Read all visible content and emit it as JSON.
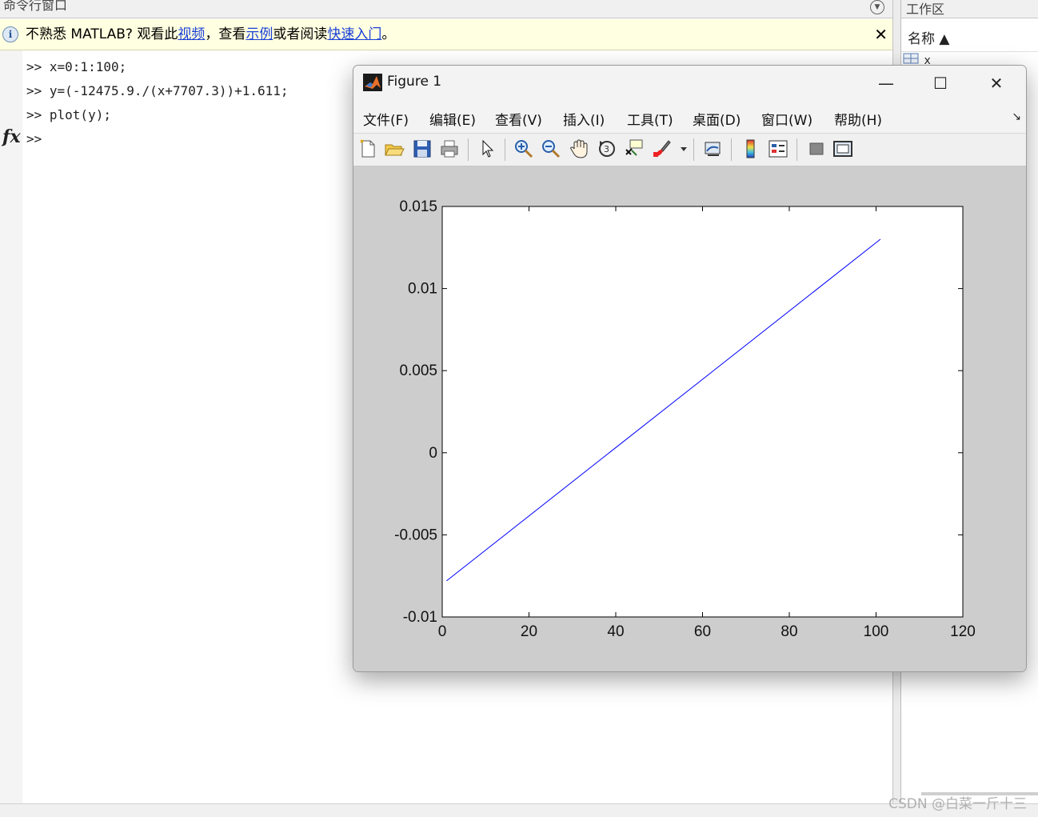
{
  "command_window": {
    "title": "命令行窗口",
    "menu_icon": "chevron-down-icon",
    "info_bar": {
      "icon": "info-icon",
      "text_before": "不熟悉 MATLAB? 观看此",
      "link_video": "视频",
      "text_mid1": "，查看",
      "link_examples": "示例",
      "text_mid2": "或者阅读",
      "link_quickstart": "快速入门",
      "text_end": "。",
      "close": "✕"
    },
    "lines": [
      ">> x=0:1:100;",
      ">> y=(-12475.9./(x+7707.3))+1.611;",
      ">> plot(y);",
      ">>"
    ],
    "fx_label": "fx"
  },
  "workspace": {
    "title": "工作区",
    "column_name": "名称 ▲",
    "variable_hint": "x"
  },
  "figure": {
    "title": "Figure 1",
    "window_controls": {
      "minimize": "—",
      "maximize": "☐",
      "close": "✕"
    },
    "menus": [
      "文件(F)",
      "编辑(E)",
      "查看(V)",
      "插入(I)",
      "工具(T)",
      "桌面(D)",
      "窗口(W)",
      "帮助(H)"
    ],
    "menu_dock": "↘",
    "toolbar": [
      "new-figure-icon",
      "open-file-icon",
      "save-icon",
      "print-icon",
      "edit-plot-arrow-icon",
      "zoom-in-icon",
      "zoom-out-icon",
      "pan-hand-icon",
      "rotate-3d-icon",
      "data-cursor-icon",
      "brush-icon",
      "link-plot-icon",
      "colorbar-icon",
      "legend-icon",
      "hide-plot-tools-icon",
      "show-plot-tools-icon"
    ]
  },
  "chart_data": {
    "type": "line",
    "x": [
      1,
      101
    ],
    "y": [
      -0.0078,
      0.013
    ],
    "series": [
      {
        "name": "",
        "x": [
          1,
          101
        ],
        "values": [
          -0.0078,
          0.013
        ],
        "color": "#0000ff"
      }
    ],
    "xlim": [
      0,
      120
    ],
    "ylim": [
      -0.01,
      0.015
    ],
    "x_ticks": [
      0,
      20,
      40,
      60,
      80,
      100,
      120
    ],
    "y_ticks": [
      -0.01,
      -0.005,
      0,
      0.005,
      0.01,
      0.015
    ],
    "x_tick_labels": [
      "0",
      "20",
      "40",
      "60",
      "80",
      "100",
      "120"
    ],
    "y_tick_labels": [
      "-0.01",
      "-0.005",
      "0",
      "0.005",
      "0.01",
      "0.015"
    ],
    "title": "",
    "xlabel": "",
    "ylabel": "",
    "grid": false
  },
  "watermark": "CSDN @白菜一斤十三"
}
